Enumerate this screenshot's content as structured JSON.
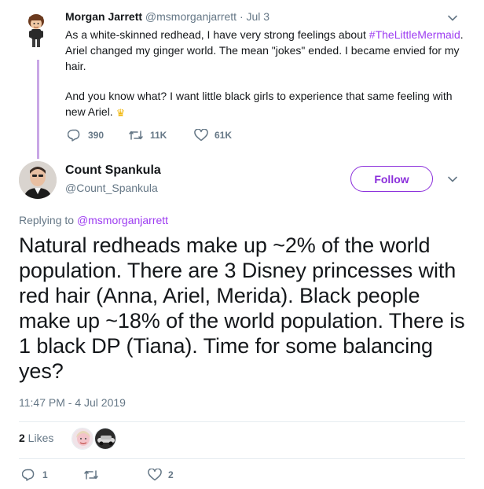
{
  "parent_tweet": {
    "name": "Morgan Jarrett",
    "handle": "@msmorganjarrett",
    "separator": "·",
    "date": "Jul 3",
    "text_line1_pre": "As a white-skinned redhead, I have very strong feelings about",
    "hashtag": "#TheLittleMermaid",
    "text_line1_post": ". Ariel changed my ginger world. The mean \"jokes\" ended. I became envied for my hair.",
    "text_para2": "And you know what? I want little black girls to experience that same feeling with new Ariel.",
    "replies": "390",
    "retweets": "11K",
    "likes": "61K"
  },
  "main_tweet": {
    "name": "Count Spankula",
    "handle": "@Count_Spankula",
    "follow_label": "Follow",
    "replying_prefix": "Replying to ",
    "replying_to": "@msmorganjarrett",
    "text": "Natural redheads make up ~2% of the world population. There are 3 Disney princesses with red hair (Anna, Ariel, Merida). Black people make up ~18% of the world population. There is 1 black DP (Tiana). Time for some balancing yes?",
    "timestamp": "11:47 PM - 4 Jul 2019",
    "likes_count": "2",
    "likes_label": " Likes",
    "replies": "1",
    "retweets": "",
    "likes": "2"
  },
  "colors": {
    "accent": "#8b2fdb",
    "link": "#9d3cf1",
    "thread_line": "#c9a7e6",
    "muted": "#657786"
  },
  "icons": [
    "chevron-down-icon",
    "reply-icon",
    "retweet-icon",
    "heart-icon",
    "crown-icon"
  ]
}
